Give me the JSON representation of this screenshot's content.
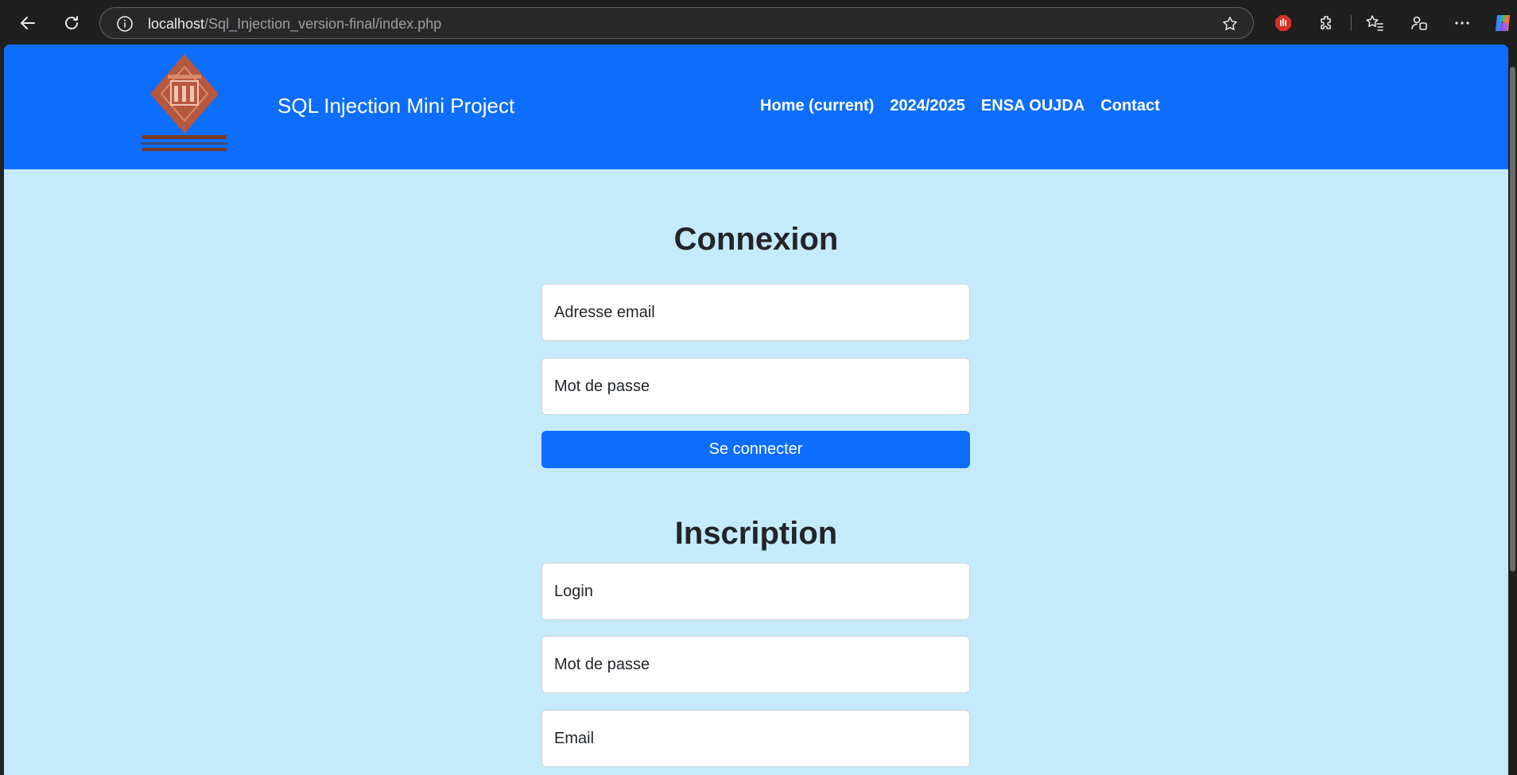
{
  "browser": {
    "url_host": "localhost",
    "url_path": "/Sql_Injection_version-final/index.php"
  },
  "navbar": {
    "brand": "SQL Injection Mini Project",
    "links": [
      "Home (current)",
      "2024/2025",
      "ENSA OUJDA",
      "Contact"
    ],
    "background": "#0d6efd"
  },
  "login": {
    "title": "Connexion",
    "email_placeholder": "Adresse email",
    "password_placeholder": "Mot de passe",
    "submit_label": "Se connecter"
  },
  "register": {
    "title": "Inscription",
    "login_placeholder": "Login",
    "password_placeholder": "Mot de passe",
    "email_placeholder": "Email"
  },
  "colors": {
    "page_background": "#c5eafc",
    "primary": "#0d6efd",
    "logo": "#b5583d"
  },
  "icons": [
    "back-icon",
    "reload-icon",
    "info-icon",
    "star-icon",
    "adblock-icon",
    "extensions-icon",
    "favorites-icon",
    "profile-icon",
    "more-icon",
    "copilot-icon",
    "university-logo"
  ]
}
